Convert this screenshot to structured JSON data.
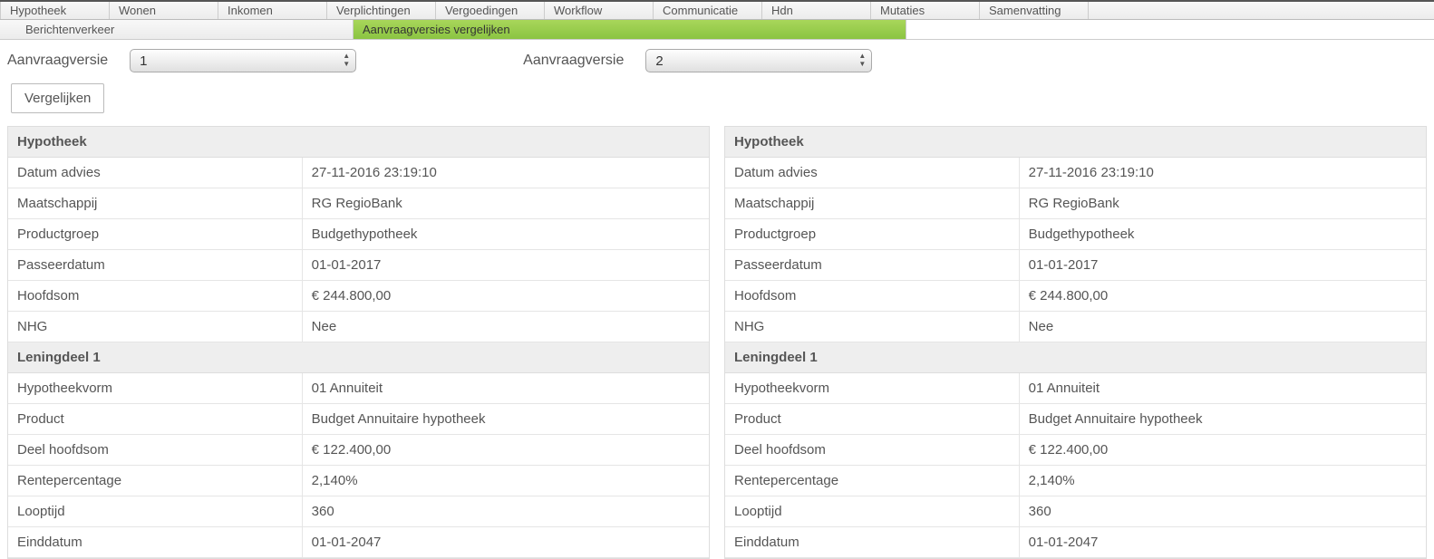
{
  "topTabs": [
    "Hypotheek",
    "Wonen",
    "Inkomen",
    "Verplichtingen",
    "Vergoedingen",
    "Workflow",
    "Communicatie",
    "Hdn",
    "Mutaties",
    "Samenvatting"
  ],
  "subTabs": {
    "items": [
      "Berichtenverkeer",
      "Aanvraagversies vergelijken"
    ],
    "activeIndex": 1
  },
  "controls": {
    "label1": "Aanvraagversie",
    "select1_value": "1",
    "label2": "Aanvraagversie",
    "select2_value": "2",
    "compare_button": "Vergelijken"
  },
  "panelLeft": {
    "sections": [
      {
        "title": "Hypotheek",
        "rows": [
          {
            "k": "Datum advies",
            "v": "27-11-2016 23:19:10"
          },
          {
            "k": "Maatschappij",
            "v": "RG RegioBank"
          },
          {
            "k": "Productgroep",
            "v": "Budgethypotheek"
          },
          {
            "k": "Passeerdatum",
            "v": "01-01-2017"
          },
          {
            "k": "Hoofdsom",
            "v": "€ 244.800,00"
          },
          {
            "k": "NHG",
            "v": "Nee"
          }
        ]
      },
      {
        "title": "Leningdeel 1",
        "rows": [
          {
            "k": "Hypotheekvorm",
            "v": "01 Annuiteit"
          },
          {
            "k": "Product",
            "v": "Budget Annuitaire hypotheek"
          },
          {
            "k": "Deel hoofdsom",
            "v": "€ 122.400,00"
          },
          {
            "k": "Rentepercentage",
            "v": "2,140%"
          },
          {
            "k": "Looptijd",
            "v": "360"
          },
          {
            "k": "Einddatum",
            "v": "01-01-2047"
          }
        ]
      }
    ]
  },
  "panelRight": {
    "sections": [
      {
        "title": "Hypotheek",
        "rows": [
          {
            "k": "Datum advies",
            "v": "27-11-2016 23:19:10"
          },
          {
            "k": "Maatschappij",
            "v": "RG RegioBank"
          },
          {
            "k": "Productgroep",
            "v": "Budgethypotheek"
          },
          {
            "k": "Passeerdatum",
            "v": "01-01-2017"
          },
          {
            "k": "Hoofdsom",
            "v": "€ 244.800,00"
          },
          {
            "k": "NHG",
            "v": "Nee"
          }
        ]
      },
      {
        "title": "Leningdeel 1",
        "rows": [
          {
            "k": "Hypotheekvorm",
            "v": "01 Annuiteit"
          },
          {
            "k": "Product",
            "v": "Budget Annuitaire hypotheek"
          },
          {
            "k": "Deel hoofdsom",
            "v": "€ 122.400,00"
          },
          {
            "k": "Rentepercentage",
            "v": "2,140%"
          },
          {
            "k": "Looptijd",
            "v": "360"
          },
          {
            "k": "Einddatum",
            "v": "01-01-2047"
          }
        ]
      }
    ]
  }
}
